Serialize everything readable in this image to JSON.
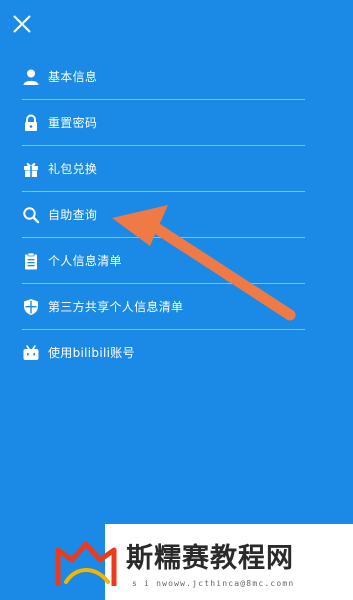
{
  "menu": {
    "items": [
      {
        "label": "基本信息",
        "icon": "user-icon"
      },
      {
        "label": "重置密码",
        "icon": "lock-icon"
      },
      {
        "label": "礼包兑换",
        "icon": "gift-icon"
      },
      {
        "label": "自助查询",
        "icon": "search-icon"
      },
      {
        "label": "个人信息清单",
        "icon": "clipboard-icon"
      },
      {
        "label": "第三方共享个人信息清单",
        "icon": "shield-icon"
      },
      {
        "label": "使用bilibili账号",
        "icon": "bilibili-tv-icon"
      }
    ]
  },
  "watermark": {
    "title": "斯糯赛教程网",
    "url": "s i nwoww.jcthinca@8mc.comn"
  },
  "colors": {
    "panel_background": "#1a8ae6",
    "arrow": "#f07a45",
    "text": "#ffffff"
  }
}
